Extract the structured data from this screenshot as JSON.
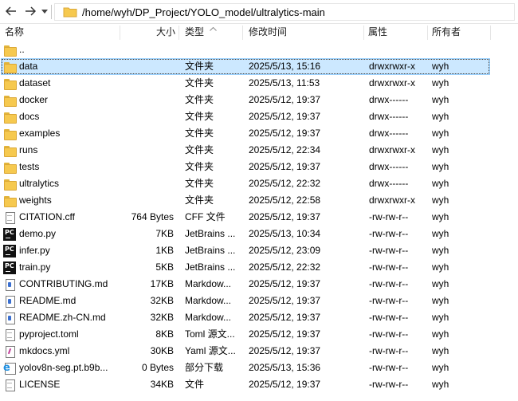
{
  "toolbar": {
    "back_icon": "arrow-left-icon",
    "forward_icon": "arrow-right-icon",
    "dropdown_icon": "chevron-down-icon",
    "path": "/home/wyh/DP_Project/YOLO_model/ultralytics-main"
  },
  "columns": {
    "name": "名称",
    "size": "大小",
    "type": "类型",
    "mtime": "修改时间",
    "perm": "属性",
    "owner": "所有者"
  },
  "rows": [
    {
      "icon": "folder",
      "name": "..",
      "size": "",
      "type": "",
      "mtime": "",
      "perm": "",
      "owner": ""
    },
    {
      "icon": "folder",
      "name": "data",
      "size": "",
      "type": "文件夹",
      "mtime": "2025/5/13, 15:16",
      "perm": "drwxrwxr-x",
      "owner": "wyh"
    },
    {
      "icon": "folder",
      "name": "dataset",
      "size": "",
      "type": "文件夹",
      "mtime": "2025/5/13, 11:53",
      "perm": "drwxrwxr-x",
      "owner": "wyh"
    },
    {
      "icon": "folder",
      "name": "docker",
      "size": "",
      "type": "文件夹",
      "mtime": "2025/5/12, 19:37",
      "perm": "drwx------",
      "owner": "wyh"
    },
    {
      "icon": "folder",
      "name": "docs",
      "size": "",
      "type": "文件夹",
      "mtime": "2025/5/12, 19:37",
      "perm": "drwx------",
      "owner": "wyh"
    },
    {
      "icon": "folder",
      "name": "examples",
      "size": "",
      "type": "文件夹",
      "mtime": "2025/5/12, 19:37",
      "perm": "drwx------",
      "owner": "wyh"
    },
    {
      "icon": "folder",
      "name": "runs",
      "size": "",
      "type": "文件夹",
      "mtime": "2025/5/12, 22:34",
      "perm": "drwxrwxr-x",
      "owner": "wyh"
    },
    {
      "icon": "folder",
      "name": "tests",
      "size": "",
      "type": "文件夹",
      "mtime": "2025/5/12, 19:37",
      "perm": "drwx------",
      "owner": "wyh"
    },
    {
      "icon": "folder",
      "name": "ultralytics",
      "size": "",
      "type": "文件夹",
      "mtime": "2025/5/12, 22:32",
      "perm": "drwx------",
      "owner": "wyh"
    },
    {
      "icon": "folder",
      "name": "weights",
      "size": "",
      "type": "文件夹",
      "mtime": "2025/5/12, 22:58",
      "perm": "drwxrwxr-x",
      "owner": "wyh"
    },
    {
      "icon": "doc",
      "name": "CITATION.cff",
      "size": "764 Bytes",
      "type": "CFF 文件",
      "mtime": "2025/5/12, 19:37",
      "perm": "-rw-rw-r--",
      "owner": "wyh"
    },
    {
      "icon": "pc",
      "name": "demo.py",
      "size": "7KB",
      "type": "JetBrains ...",
      "mtime": "2025/5/13, 10:34",
      "perm": "-rw-rw-r--",
      "owner": "wyh"
    },
    {
      "icon": "pc",
      "name": "infer.py",
      "size": "1KB",
      "type": "JetBrains ...",
      "mtime": "2025/5/12, 23:09",
      "perm": "-rw-rw-r--",
      "owner": "wyh"
    },
    {
      "icon": "pc",
      "name": "train.py",
      "size": "5KB",
      "type": "JetBrains ...",
      "mtime": "2025/5/12, 22:32",
      "perm": "-rw-rw-r--",
      "owner": "wyh"
    },
    {
      "icon": "md",
      "name": "CONTRIBUTING.md",
      "size": "17KB",
      "type": "Markdow...",
      "mtime": "2025/5/12, 19:37",
      "perm": "-rw-rw-r--",
      "owner": "wyh"
    },
    {
      "icon": "md",
      "name": "README.md",
      "size": "32KB",
      "type": "Markdow...",
      "mtime": "2025/5/12, 19:37",
      "perm": "-rw-rw-r--",
      "owner": "wyh"
    },
    {
      "icon": "md",
      "name": "README.zh-CN.md",
      "size": "32KB",
      "type": "Markdow...",
      "mtime": "2025/5/12, 19:37",
      "perm": "-rw-rw-r--",
      "owner": "wyh"
    },
    {
      "icon": "doc",
      "name": "pyproject.toml",
      "size": "8KB",
      "type": "Toml 源文...",
      "mtime": "2025/5/12, 19:37",
      "perm": "-rw-rw-r--",
      "owner": "wyh"
    },
    {
      "icon": "yml",
      "name": "mkdocs.yml",
      "size": "30KB",
      "type": "Yaml 源文...",
      "mtime": "2025/5/12, 19:37",
      "perm": "-rw-rw-r--",
      "owner": "wyh"
    },
    {
      "icon": "ie",
      "name": "yolov8n-seg.pt.b9b...",
      "size": "0 Bytes",
      "type": "部分下载",
      "mtime": "2025/5/13, 15:36",
      "perm": "-rw-rw-r--",
      "owner": "wyh"
    },
    {
      "icon": "doc",
      "name": "LICENSE",
      "size": "34KB",
      "type": "文件",
      "mtime": "2025/5/12, 19:37",
      "perm": "-rw-rw-r--",
      "owner": "wyh"
    }
  ],
  "selected_row": "data",
  "colors": {
    "selection_bg": "#cce8ff",
    "selection_border": "#99d1ff",
    "folder": "#f6c94f"
  }
}
